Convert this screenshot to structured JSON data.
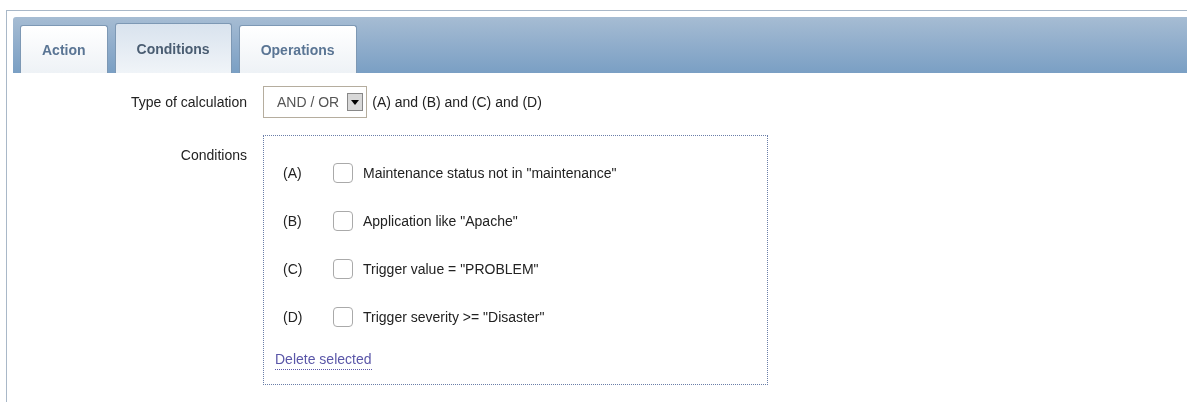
{
  "tabs": [
    {
      "label": "Action",
      "selected": false
    },
    {
      "label": "Conditions",
      "selected": true
    },
    {
      "label": "Operations",
      "selected": false
    }
  ],
  "calculation": {
    "label": "Type of calculation",
    "value": "AND / OR",
    "formula": "(A) and (B) and (C) and (D)"
  },
  "conditions": {
    "label": "Conditions",
    "items": [
      {
        "letter": "(A)",
        "text": "Maintenance status not in \"maintenance\"",
        "checked": false
      },
      {
        "letter": "(B)",
        "text": "Application like \"Apache\"",
        "checked": false
      },
      {
        "letter": "(C)",
        "text": "Trigger value = \"PROBLEM\"",
        "checked": false
      },
      {
        "letter": "(D)",
        "text": "Trigger severity >= \"Disaster\"",
        "checked": false
      }
    ],
    "delete_link": "Delete selected"
  }
}
